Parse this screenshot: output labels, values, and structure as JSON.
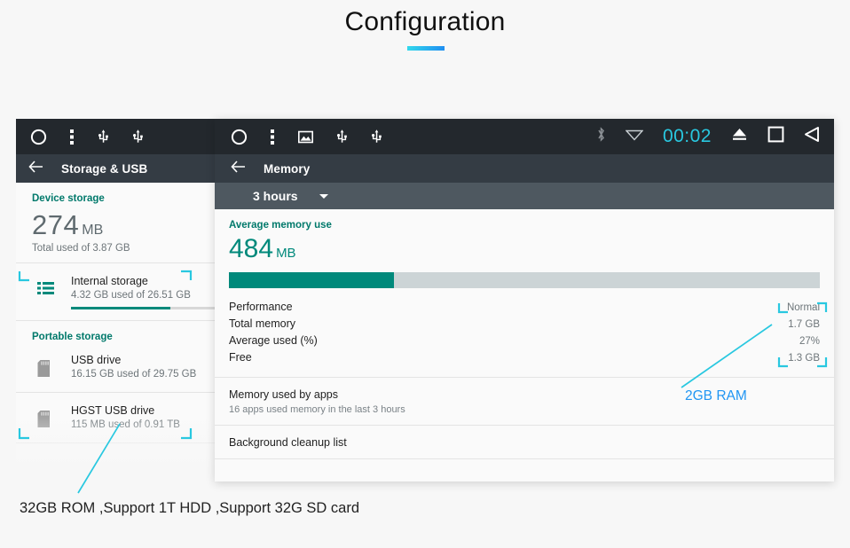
{
  "page": {
    "title": "Configuration",
    "accent_start": "#32d8ec",
    "accent_end": "#1f8ef1",
    "background": "#f7f7f7",
    "teal": "#00897b",
    "annotation_blue": "#2196f3",
    "annotation_cyan": "#29c8e0"
  },
  "storage_panel": {
    "statusbar": {
      "icons": [
        "circle-icon",
        "overflow-menu-icon",
        "usb-icon",
        "usb-icon"
      ]
    },
    "titlebar": {
      "back_icon": "back-arrow-icon",
      "title": "Storage & USB"
    },
    "device_storage": {
      "header": "Device storage",
      "value": "274",
      "unit": "MB",
      "sub": "Total used of 3.87 GB"
    },
    "internal": {
      "icon": "internal-storage-icon",
      "title": "Internal storage",
      "sub": "4.32 GB used of 26.51 GB",
      "bar_percent": 65
    },
    "portable": {
      "header": "Portable storage",
      "items": [
        {
          "icon": "sd-card-icon",
          "title": "USB drive",
          "sub": "16.15 GB used of 29.75 GB"
        },
        {
          "icon": "sd-card-icon",
          "title": "HGST USB drive",
          "sub": "115 MB used of 0.91 TB"
        }
      ]
    }
  },
  "memory_panel": {
    "statusbar": {
      "left_icons": [
        "circle-icon",
        "overflow-menu-icon",
        "image-icon",
        "usb-icon",
        "usb-icon"
      ],
      "bluetooth_icon": "bluetooth-icon",
      "wifi_icon": "wifi-icon",
      "clock": "00:02",
      "eject_icon": "eject-icon",
      "home_icon": "home-square-icon",
      "back_icon": "back-triangle-icon"
    },
    "titlebar": {
      "back_icon": "back-arrow-icon",
      "title": "Memory"
    },
    "range_selector": {
      "label": "3 hours",
      "caret_icon": "chevron-down-icon"
    },
    "average": {
      "header": "Average memory use",
      "value": "484",
      "unit": "MB",
      "bar_percent": 28
    },
    "stats": [
      {
        "label": "Performance",
        "value": "Normal"
      },
      {
        "label": "Total memory",
        "value": "1.7 GB"
      },
      {
        "label": "Average used (%)",
        "value": "27%"
      },
      {
        "label": "Free",
        "value": "1.3 GB"
      }
    ],
    "apps": {
      "title": "Memory used by apps",
      "sub": "16 apps used memory in the last 3 hours"
    },
    "cleanup": {
      "title": "Background cleanup list"
    }
  },
  "annotations": {
    "ram_label": "2GB RAM",
    "caption": "32GB ROM ,Support 1T HDD ,Support 32G SD card"
  }
}
